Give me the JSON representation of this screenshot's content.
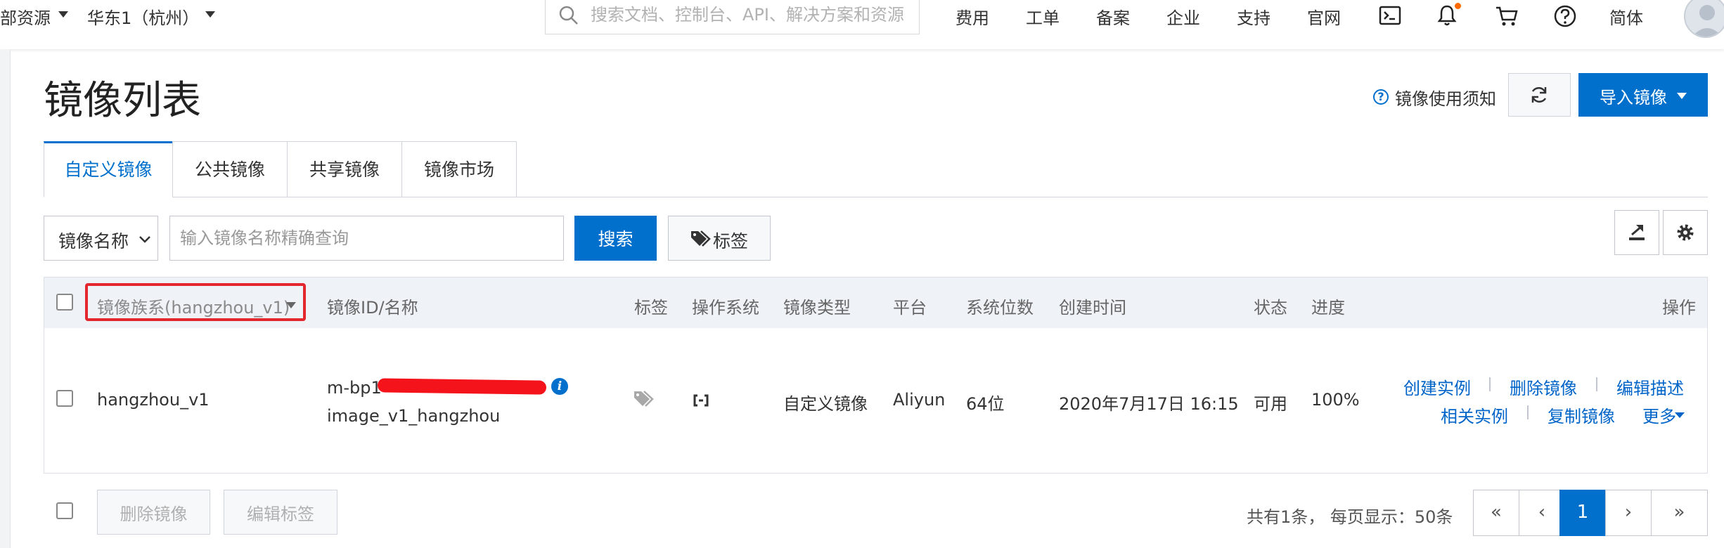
{
  "topbar": {
    "left_menu_label": "部资源",
    "region_label": "华东1（杭州）",
    "search_placeholder": "搜索文档、控制台、API、解决方案和资源",
    "nav": [
      "费用",
      "工单",
      "备案",
      "企业",
      "支持",
      "官网"
    ],
    "lang": "简体",
    "icons": [
      "terminal-icon",
      "bell-icon",
      "cart-icon",
      "help-icon",
      "avatar"
    ]
  },
  "header": {
    "title": "镜像列表",
    "notice_link": "镜像使用须知",
    "import_button": "导入镜像"
  },
  "tabs": [
    {
      "label": "自定义镜像",
      "active": true
    },
    {
      "label": "公共镜像",
      "active": false
    },
    {
      "label": "共享镜像",
      "active": false
    },
    {
      "label": "镜像市场",
      "active": false
    }
  ],
  "filter": {
    "select_label": "镜像名称",
    "input_placeholder": "输入镜像名称精确查询",
    "search_button": "搜索",
    "tag_button": "标签"
  },
  "table": {
    "columns": [
      "镜像族系(hangzhou_v1)",
      "镜像ID/名称",
      "标签",
      "操作系统",
      "镜像类型",
      "平台",
      "系统位数",
      "创建时间",
      "状态",
      "进度",
      "操作"
    ],
    "rows": [
      {
        "family": "hangzhou_v1",
        "image_id": "m-bp1",
        "image_name": "image_v1_hangzhou",
        "type": "自定义镜像",
        "platform": "Aliyun",
        "bits": "64位",
        "created": "2020年7月17日 16:15",
        "status": "可用",
        "progress": "100%",
        "actions_row1": [
          "创建实例",
          "删除镜像",
          "编辑描述"
        ],
        "actions_row2": [
          "相关实例",
          "复制镜像",
          "更多"
        ]
      }
    ]
  },
  "footer": {
    "delete_button": "删除镜像",
    "edit_tag_button": "编辑标签",
    "summary": "共有1条， 每页显示：50条",
    "pages": [
      "«",
      "‹",
      "1",
      "›",
      "»"
    ],
    "current_page": "1"
  },
  "colors": {
    "accent": "#0070cc",
    "highlight": "#e2272e",
    "notif": "#ff6a00"
  }
}
